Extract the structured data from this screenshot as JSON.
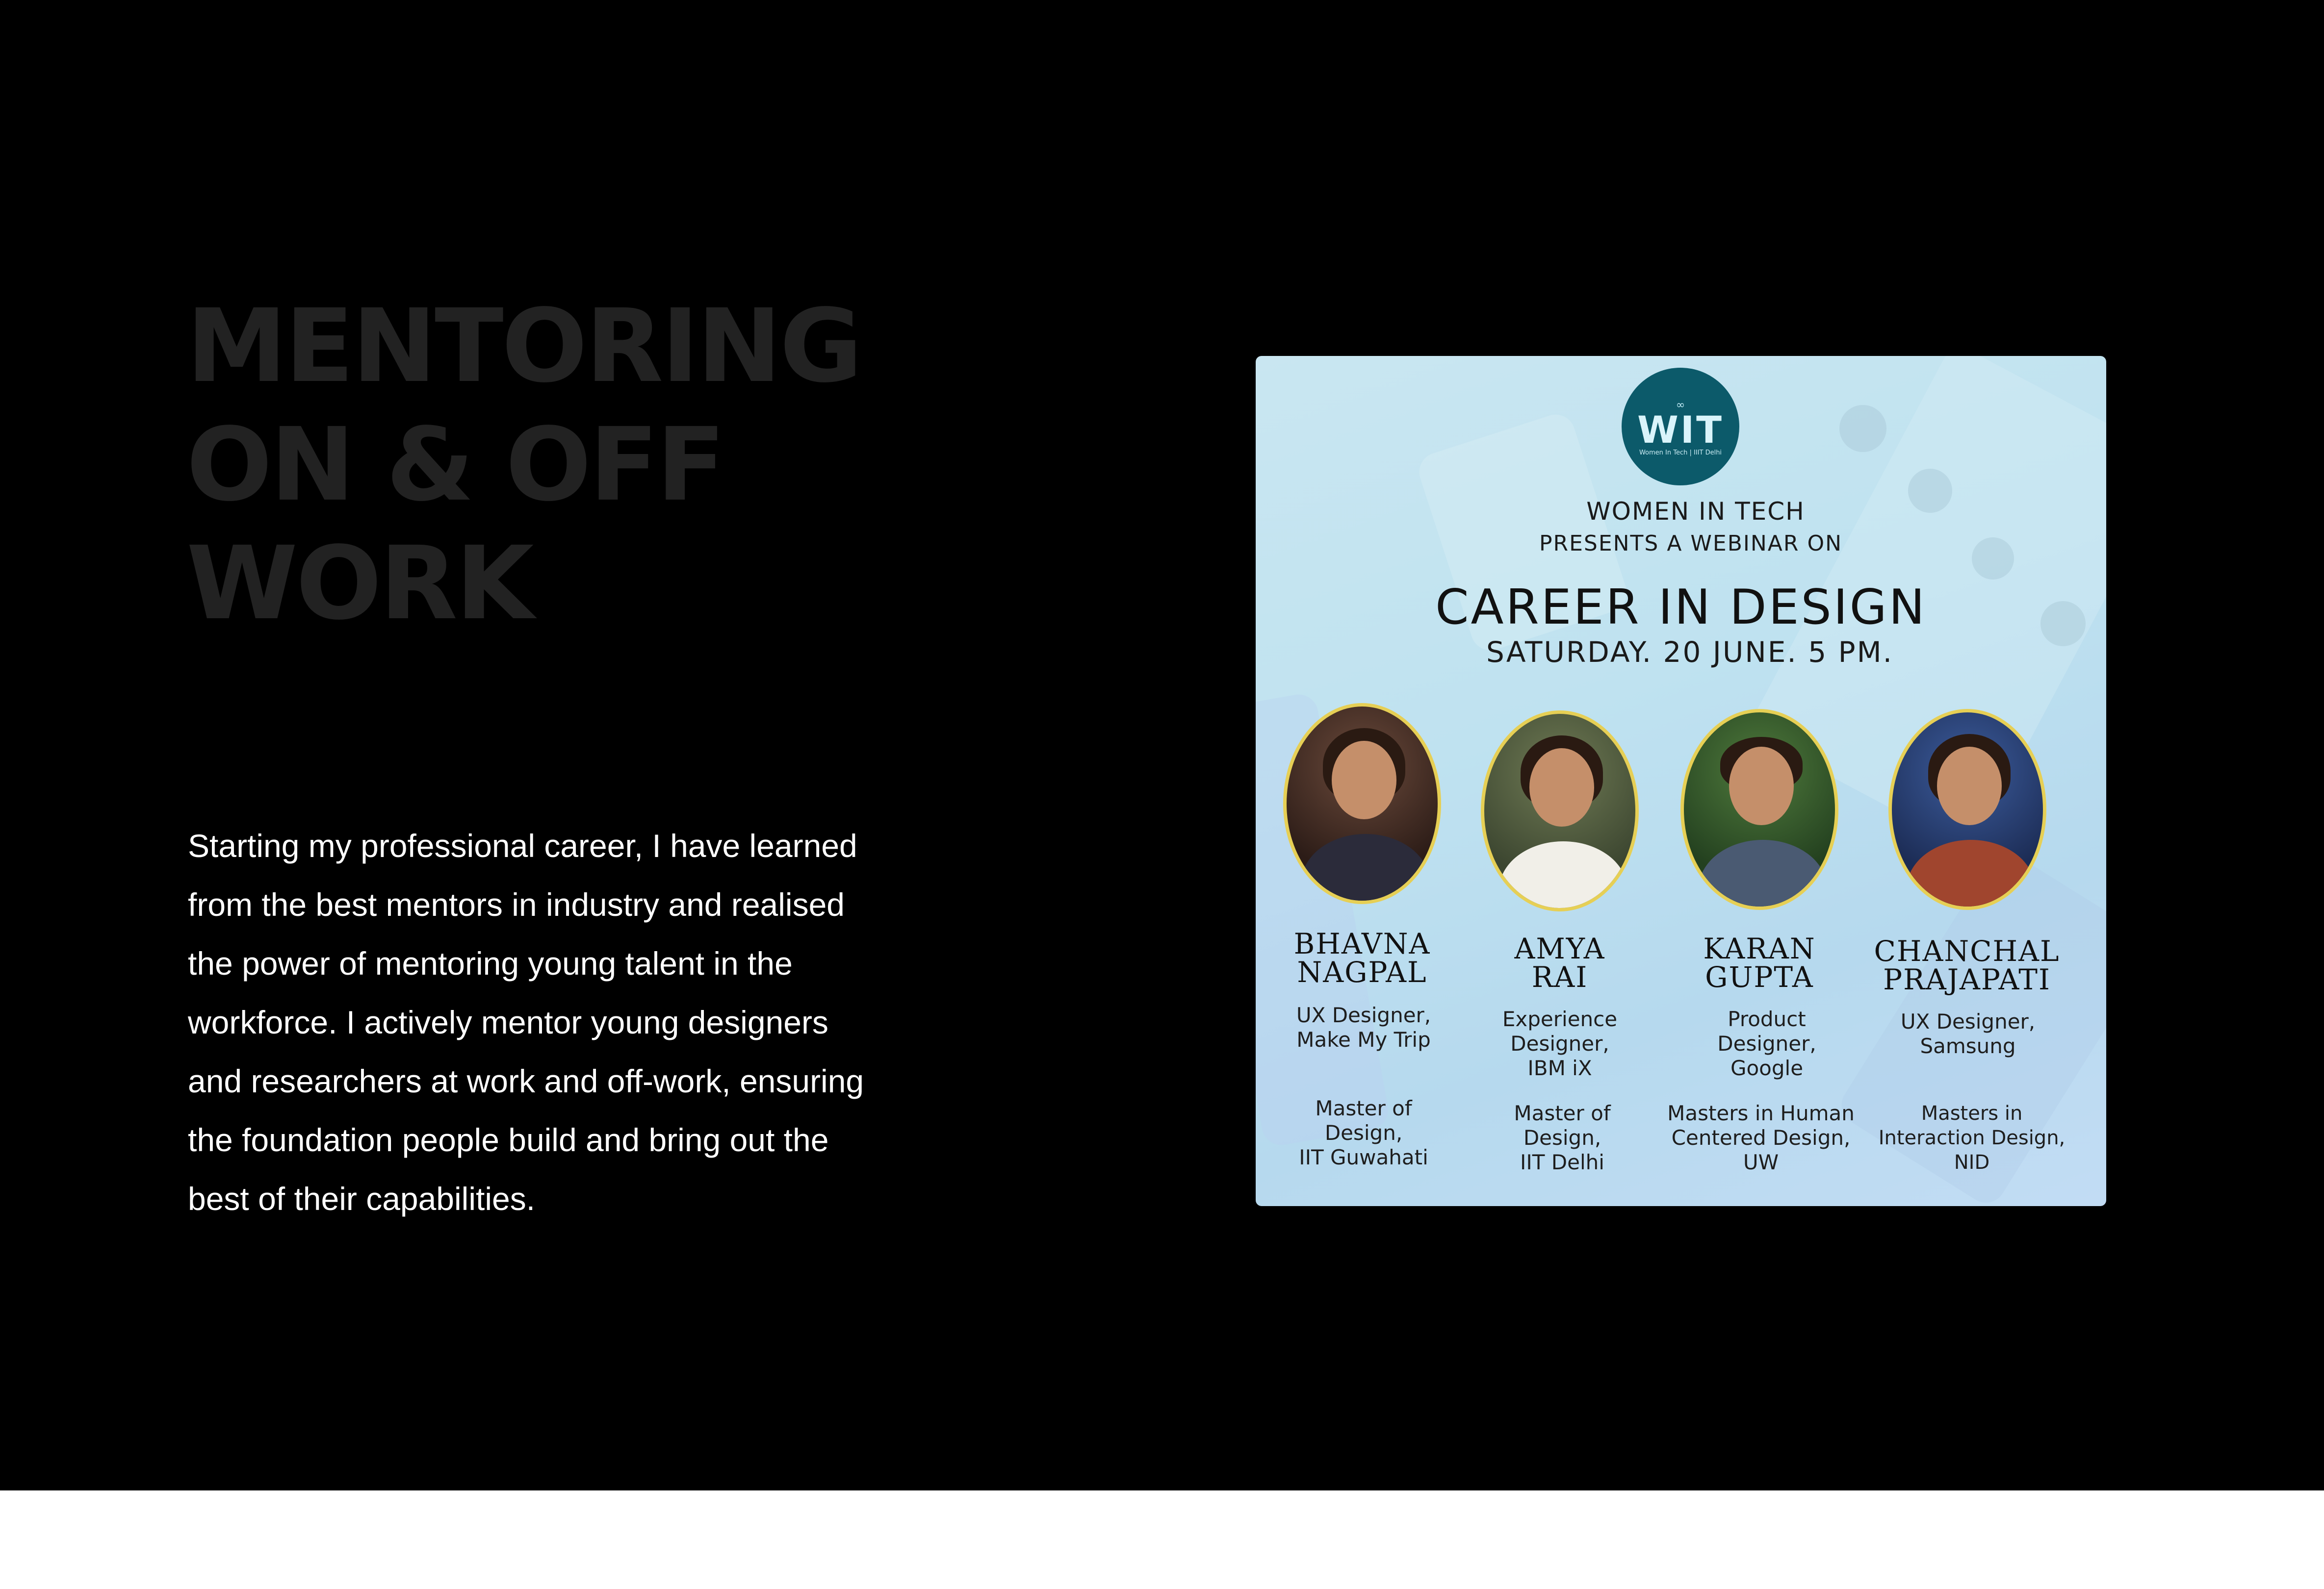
{
  "section": {
    "heading_lines": [
      "MENTORING",
      "ON & OFF",
      "WORK"
    ],
    "body": "Starting my professional career, I have learned from the best mentors in industry and realised the power of mentoring young talent in the workforce. I actively mentor young designers and researchers at work and off-work, ensuring the foundation people build and bring out the best of their capabilities."
  },
  "poster": {
    "logo_mark": "WIT",
    "logo_subtitle": "Women In Tech | IIIT Delhi",
    "org": "WOMEN IN TECH",
    "presents": "PRESENTS A WEBINAR ON",
    "title": "CAREER IN DESIGN",
    "date": "SATURDAY. 20 JUNE. 5 PM.",
    "speakers": [
      {
        "name_lines": [
          "BHAVNA",
          "NAGPAL"
        ],
        "role_lines": [
          "UX Designer,",
          "Make My Trip"
        ],
        "edu_lines": [
          "Master of",
          "Design,",
          "IIT Guwahati"
        ]
      },
      {
        "name_lines": [
          "AMYA",
          "RAI"
        ],
        "role_lines": [
          "Experience",
          "Designer,",
          "IBM iX"
        ],
        "edu_lines": [
          "Master of",
          "Design,",
          "IIT Delhi"
        ]
      },
      {
        "name_lines": [
          "KARAN",
          "GUPTA"
        ],
        "role_lines": [
          "Product",
          "Designer,",
          "Google"
        ],
        "edu_lines": [
          "Masters in Human",
          "Centered Design,",
          "UW"
        ]
      },
      {
        "name_lines": [
          "CHANCHAL",
          "PRAJAPATI"
        ],
        "role_lines": [
          "UX Designer,",
          "Samsung"
        ],
        "edu_lines": [
          "Masters in",
          "Interaction Design,",
          "NID"
        ]
      }
    ]
  },
  "colors": {
    "background": "#000000",
    "heading": "#222222",
    "body_text": "#ffffff",
    "poster_bg": "#c4e4f1",
    "logo_bg": "#0c5a6a",
    "photo_ring": "#e6cf55"
  }
}
